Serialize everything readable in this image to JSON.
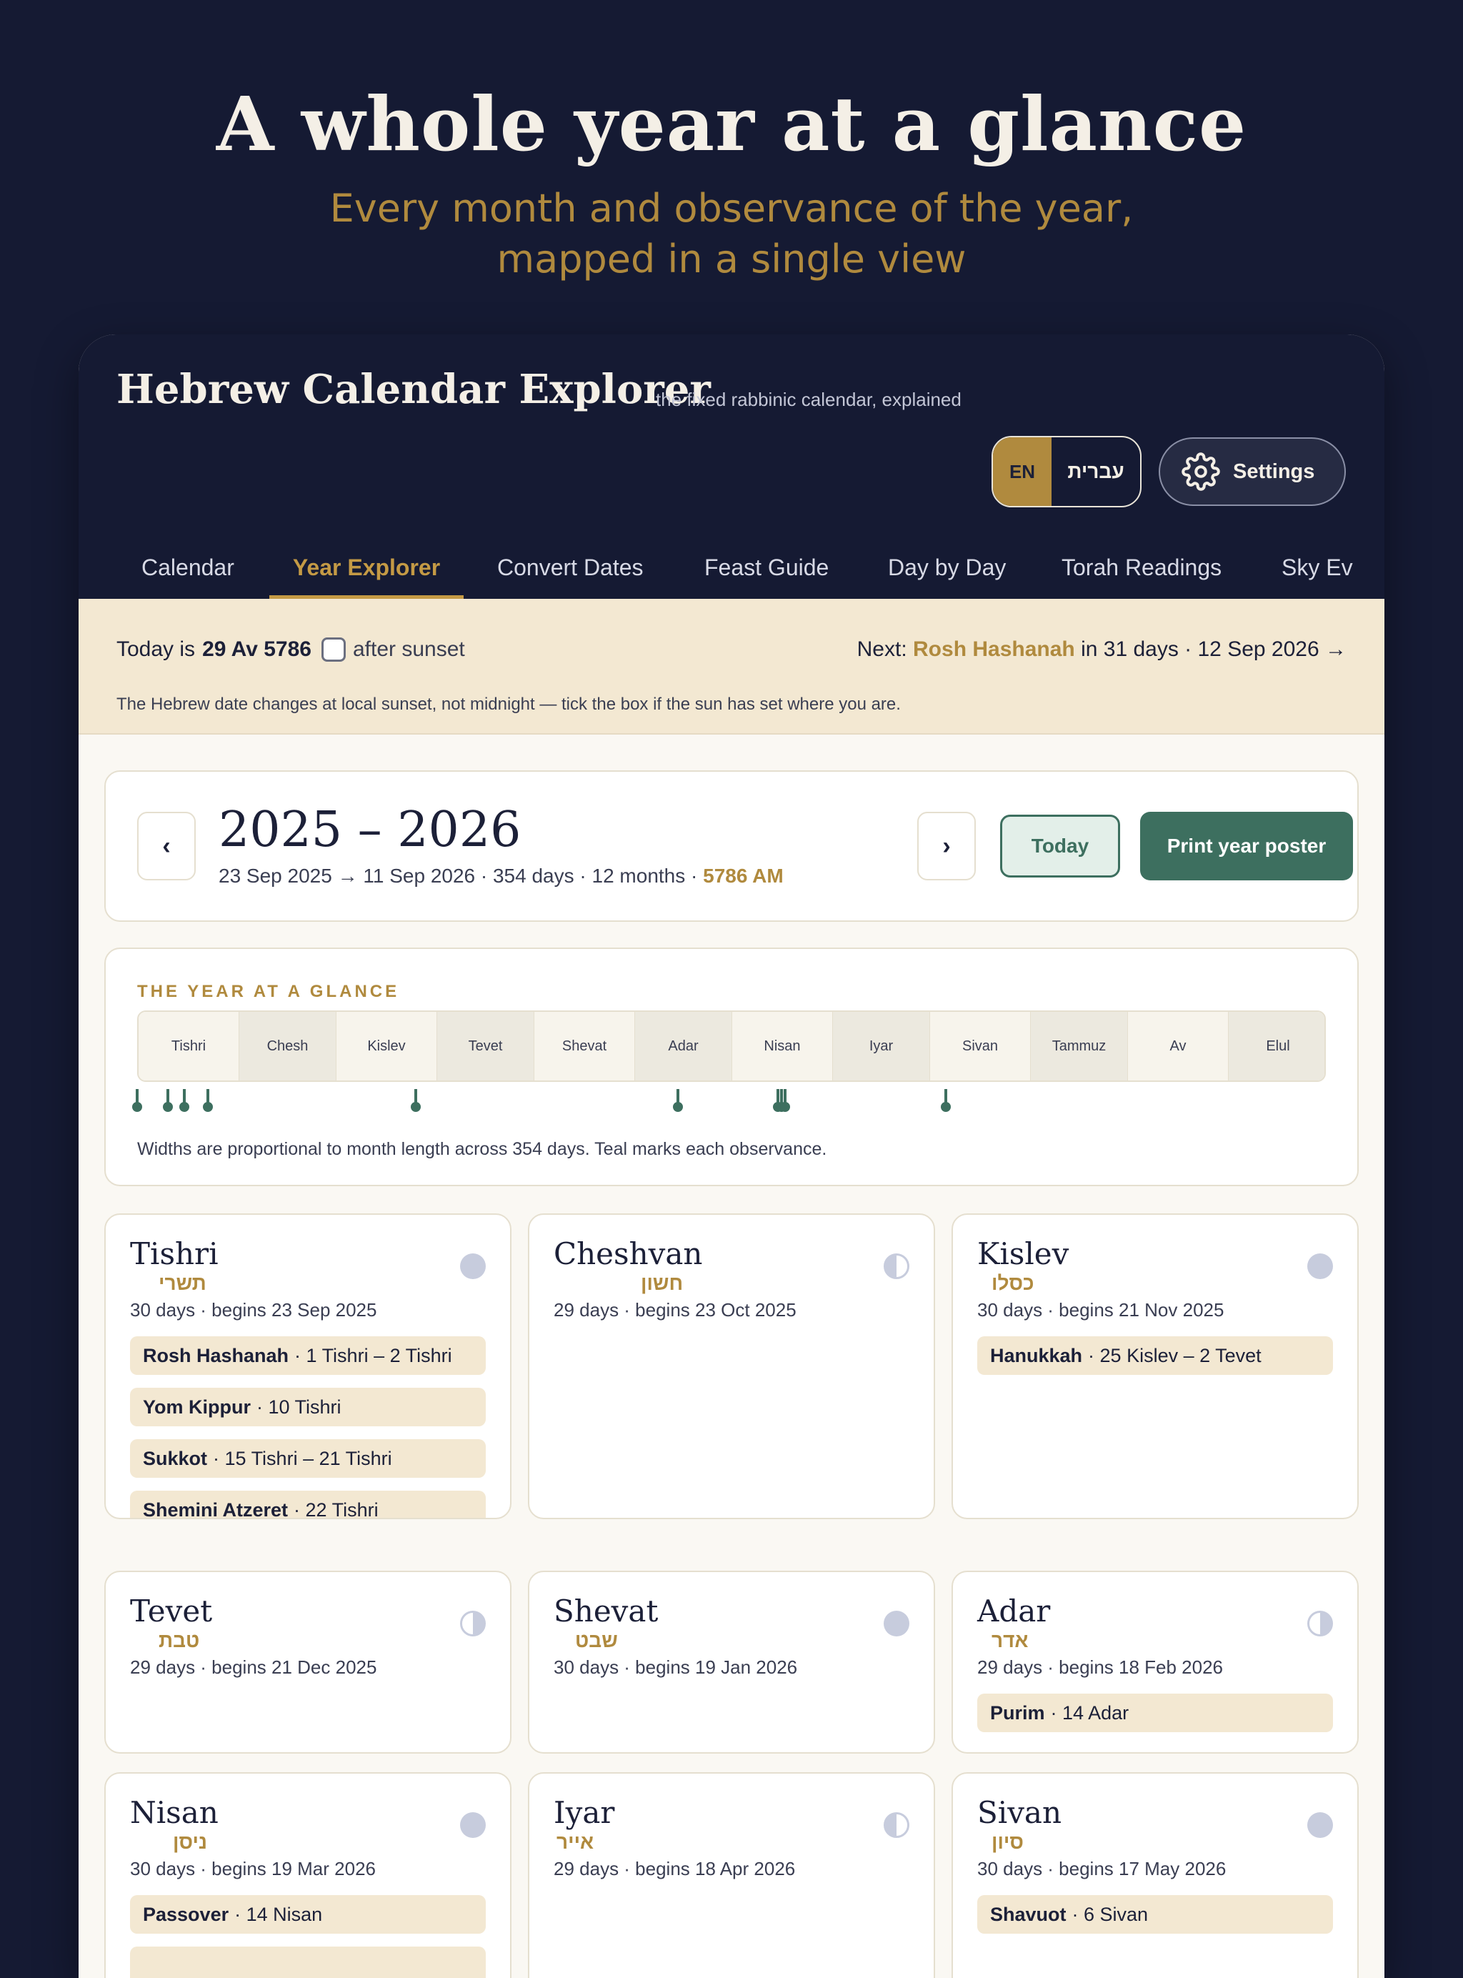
{
  "hero": {
    "title": "A whole year at a glance",
    "subtitle_line1": "Every month and observance of the year,",
    "subtitle_line2": "mapped in a single view"
  },
  "app": {
    "title": "Hebrew Calendar Explorer",
    "tagline": "the fixed rabbinic calendar, explained",
    "lang_en": "EN",
    "lang_he": "עברית",
    "settings_label": "Settings"
  },
  "tabs": [
    "Calendar",
    "Year Explorer",
    "Convert Dates",
    "Feast Guide",
    "Day by Day",
    "Torah Readings",
    "Sky Ev"
  ],
  "banner": {
    "today_prefix": "Today is",
    "today_date": "29 Av 5786",
    "after_sunset": "after sunset",
    "next_prefix": "Next:",
    "next_feast": "Rosh Hashanah",
    "next_suffix": "in 31 days · 12 Sep 2026 →",
    "note": "The Hebrew date changes at local sunset, not midnight — tick the box if the sun has set where you are."
  },
  "year": {
    "prev": "‹",
    "next": "›",
    "range": "2025 – 2026",
    "meta": "23 Sep 2025 → 11 Sep 2026 · 354 days · 12 months ·",
    "am": "5786 AM",
    "today_btn": "Today",
    "print_btn": "Print year poster"
  },
  "glance": {
    "title": "THE YEAR AT A GLANCE",
    "strip": [
      "Tishri",
      "Chesh",
      "Kislev",
      "Tevet",
      "Shevat",
      "Adar",
      "Nisan",
      "Iyar",
      "Sivan",
      "Tammuz",
      "Av",
      "Elul"
    ],
    "note": "Widths are proportional to month length across 354 days. Teal marks each observance."
  },
  "months": [
    {
      "name": "Tishri",
      "heb": "תשרי",
      "meta": "30 days · begins 23 Sep 2025",
      "feasts": [
        {
          "name": "Rosh Hashanah",
          "date": "· 1 Tishri – 2 Tishri"
        },
        {
          "name": "Yom Kippur",
          "date": "· 10 Tishri"
        },
        {
          "name": "Sukkot",
          "date": "· 15 Tishri – 21 Tishri"
        },
        {
          "name": "Shemini Atzeret",
          "date": "· 22 Tishri"
        }
      ]
    },
    {
      "name": "Cheshvan",
      "heb": "חשון",
      "meta": "29 days · begins 23 Oct 2025",
      "feasts": []
    },
    {
      "name": "Kislev",
      "heb": "כסלו",
      "meta": "30 days · begins 21 Nov 2025",
      "feasts": [
        {
          "name": "Hanukkah",
          "date": "· 25 Kislev – 2 Tevet"
        }
      ]
    },
    {
      "name": "Tevet",
      "heb": "טבת",
      "meta": "29 days · begins 21 Dec 2025",
      "feasts": []
    },
    {
      "name": "Shevat",
      "heb": "שבט",
      "meta": "30 days · begins 19 Jan 2026",
      "feasts": []
    },
    {
      "name": "Adar",
      "heb": "אדר",
      "meta": "29 days · begins 18 Feb 2026",
      "feasts": [
        {
          "name": "Purim",
          "date": "· 14 Adar"
        }
      ]
    },
    {
      "name": "Nisan",
      "heb": "ניסן",
      "meta": "30 days · begins 19 Mar 2026",
      "feasts": [
        {
          "name": "Passover",
          "date": "· 14 Nisan"
        }
      ]
    },
    {
      "name": "Iyar",
      "heb": "אייר",
      "meta": "29 days · begins 18 Apr 2026",
      "feasts": []
    },
    {
      "name": "Sivan",
      "heb": "סיון",
      "meta": "30 days · begins 17 May 2026",
      "feasts": [
        {
          "name": "Shavuot",
          "date": "· 6 Sivan"
        }
      ]
    }
  ]
}
